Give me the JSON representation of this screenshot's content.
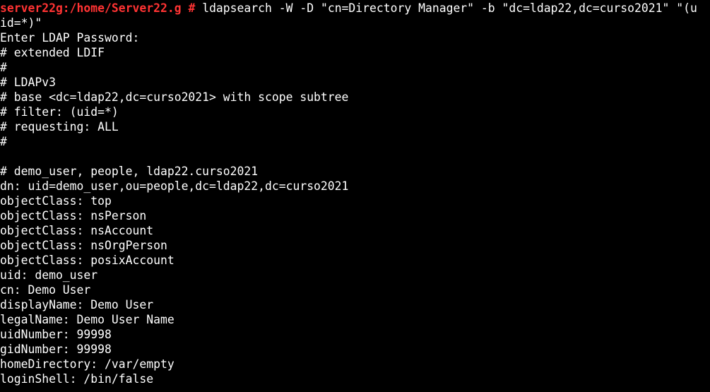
{
  "prompt": {
    "user_host_path": "server22g:/home/Server22.g",
    "symbol": "#",
    "command": " ldapsearch -W -D \"cn=Directory Manager\" -b \"dc=ldap22,dc=curso2021\" \"(u",
    "command_wrap": "id=*)\""
  },
  "output_lines": [
    "Enter LDAP Password:",
    "# extended LDIF",
    "#",
    "# LDAPv3",
    "# base <dc=ldap22,dc=curso2021> with scope subtree",
    "# filter: (uid=*)",
    "# requesting: ALL",
    "#",
    "",
    "# demo_user, people, ldap22.curso2021",
    "dn: uid=demo_user,ou=people,dc=ldap22,dc=curso2021",
    "objectClass: top",
    "objectClass: nsPerson",
    "objectClass: nsAccount",
    "objectClass: nsOrgPerson",
    "objectClass: posixAccount",
    "uid: demo_user",
    "cn: Demo User",
    "displayName: Demo User",
    "legalName: Demo User Name",
    "uidNumber: 99998",
    "gidNumber: 99998",
    "homeDirectory: /var/empty",
    "loginShell: /bin/false"
  ],
  "colors": {
    "background": "#000000",
    "foreground": "#ffffff",
    "prompt": "#ff3333"
  }
}
